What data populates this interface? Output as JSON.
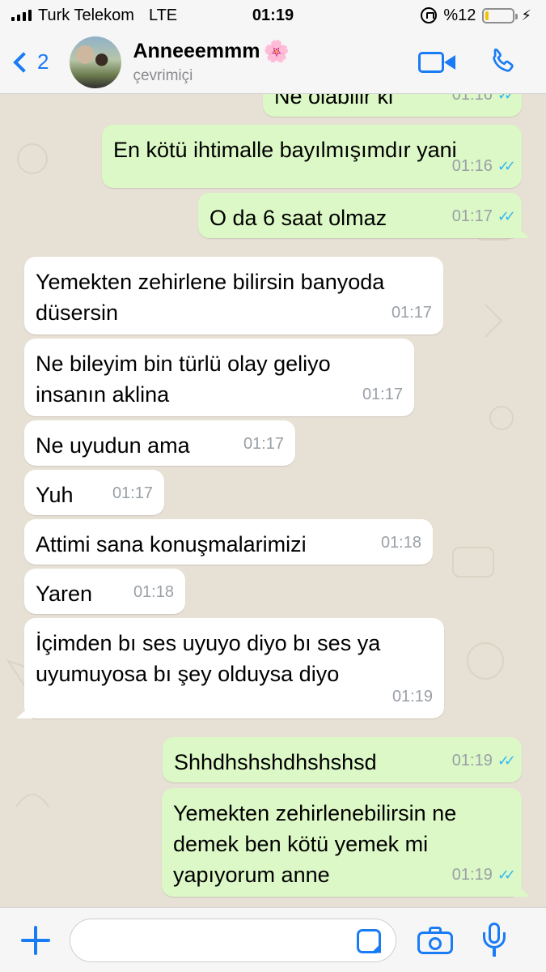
{
  "status_bar": {
    "carrier": "Turk Telekom",
    "network": "LTE",
    "time": "01:19",
    "battery_text": "%12",
    "battery_level": 0.12,
    "battery_color": "#f2c200"
  },
  "header": {
    "back_count": "2",
    "contact_name": "Anneeemmm",
    "name_emoji": "🌸",
    "contact_status": "çevrimiçi",
    "accent_color": "#1a7cf5",
    "icons": [
      "back-chevron-icon",
      "video-call-icon",
      "phone-icon"
    ]
  },
  "messages": [
    {
      "dir": "out",
      "text": "Ne olabilir ki",
      "time": "01:16",
      "read": true,
      "partial": true
    },
    {
      "dir": "out",
      "text": "En kötü ihtimalle bayılmışımdır yani",
      "time": "01:16",
      "read": true
    },
    {
      "dir": "out",
      "text": "O da 6 saat olmaz",
      "time": "01:17",
      "read": true
    },
    {
      "dir": "in",
      "text": "Yemekten zehirlene bilirsin banyoda\ndüsersin",
      "time": "01:17"
    },
    {
      "dir": "in",
      "text": "Ne bileyim bin türlü olay geliyo\ninsanın aklina",
      "time": "01:17"
    },
    {
      "dir": "in",
      "text": "Ne uyudun ama",
      "time": "01:17"
    },
    {
      "dir": "in",
      "text": "Yuh",
      "time": "01:17"
    },
    {
      "dir": "in",
      "text": "Attimi sana konuşmalarimizi",
      "time": "01:18"
    },
    {
      "dir": "in",
      "text": "Yaren",
      "time": "01:18"
    },
    {
      "dir": "in",
      "text": "İçimden bı ses uyuyo diyo bı ses ya\nuyumuyosa bı şey olduysa diyo",
      "time": "01:19"
    },
    {
      "dir": "out",
      "text": "Shhdhshshdhshshsd",
      "time": "01:19",
      "read": true
    },
    {
      "dir": "out",
      "text": "Yemekten zehirlenebilirsin ne\ndemek ben kötü yemek mi\nyapıyorum anne",
      "time": "01:19",
      "read": true
    }
  ],
  "input_bar": {
    "placeholder": "",
    "icons": [
      "plus-icon",
      "sticker-icon",
      "camera-icon",
      "microphone-icon"
    ]
  },
  "colors": {
    "outgoing_bubble": "#dcf8c6",
    "incoming_bubble": "#ffffff",
    "read_ticks": "#34b7f1",
    "chat_background": "#e7e0d4"
  }
}
